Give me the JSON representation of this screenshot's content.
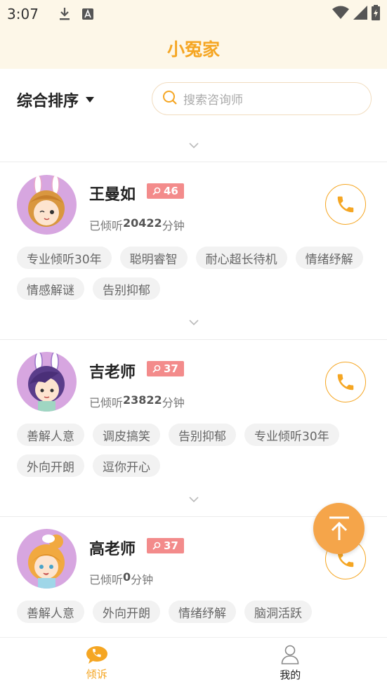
{
  "status_bar": {
    "time": "3:07"
  },
  "app": {
    "title": "小冤家"
  },
  "filter": {
    "sort_label": "综合排序",
    "search_placeholder": "搜索咨询师"
  },
  "counselors": [
    {
      "name": "王曼如",
      "badge": "46",
      "listened_prefix": "已倾听",
      "listened_value": "20422",
      "listened_unit": "分钟",
      "tags": [
        "专业倾听30年",
        "聪明睿智",
        "耐心超长待机",
        "情绪纾解",
        "情感解谜",
        "告别抑郁"
      ]
    },
    {
      "name": "吉老师",
      "badge": "37",
      "listened_prefix": "已倾听",
      "listened_value": "23822",
      "listened_unit": "分钟",
      "tags": [
        "善解人意",
        "调皮搞笑",
        "告别抑郁",
        "专业倾听30年",
        "外向开朗",
        "逗你开心"
      ]
    },
    {
      "name": "高老师",
      "badge": "37",
      "listened_prefix": "已倾听",
      "listened_value": "0",
      "listened_unit": "分钟",
      "tags": [
        "善解人意",
        "外向开朗",
        "情绪纾解",
        "脑洞活跃"
      ]
    }
  ],
  "tabbar": {
    "tab1": "倾诉",
    "tab2": "我的"
  },
  "colors": {
    "accent": "#f5a623",
    "badge": "#f38b8b",
    "header_bg": "#fdf7e8"
  },
  "icons": [
    "download-icon",
    "text-icon",
    "wifi-icon",
    "signal-icon",
    "battery-icon",
    "search-icon",
    "chevron-down-icon",
    "phone-icon",
    "back-to-top-icon",
    "person-icon"
  ]
}
